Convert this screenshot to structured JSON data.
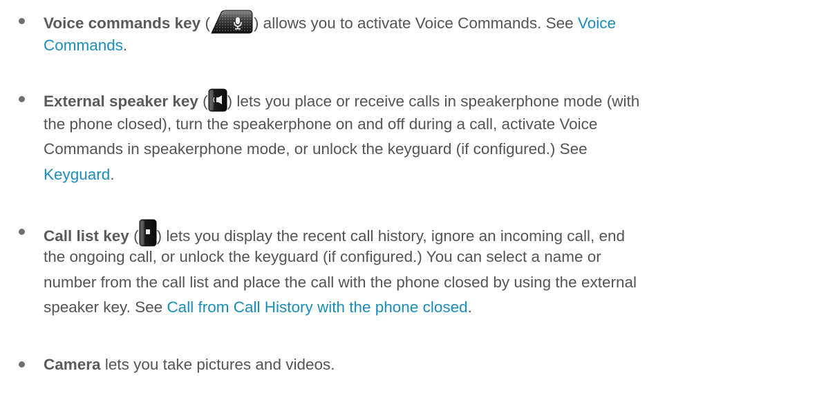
{
  "items": [
    {
      "term": "Voice commands key",
      "icon": "voice-commands-key-icon",
      "lines": {
        "open_paren": " (",
        "after_icon": ") allows you to activate Voice Commands. See ",
        "link_part1": "Voice",
        "link_part2": "Commands",
        "end": "."
      }
    },
    {
      "term": "External speaker key",
      "icon": "external-speaker-key-icon",
      "lines": {
        "open_paren": " (",
        "after_icon": ") lets you place or receive calls in speakerphone mode (with",
        "l2": "the phone closed), turn the speakerphone on and off during a call, activate Voice",
        "l3": "Commands in speakerphone mode, or unlock the keyguard (if configured.) See",
        "link": "Keyguard",
        "end": "."
      }
    },
    {
      "term": "Call list key",
      "icon": "call-list-key-icon",
      "lines": {
        "open_paren": " (",
        "after_icon": ") lets you display the recent call history, ignore an incoming call, end",
        "l2": "the ongoing call, or unlock the keyguard (if configured.) You can select a name or",
        "l3": "number from the call list and place the call with the phone closed by using the external",
        "l4_prefix": "speaker key. See ",
        "link": "Call from Call History with the phone closed",
        "end": "."
      }
    },
    {
      "term": "Camera",
      "lines": {
        "rest": " lets you take pictures and videos."
      }
    }
  ]
}
